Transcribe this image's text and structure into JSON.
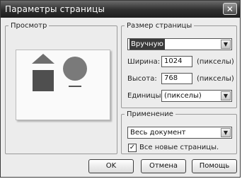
{
  "dialog": {
    "title": "Параметры страницы",
    "close_symbol": "✕"
  },
  "preview": {
    "legend": "Просмотр",
    "shapes": [
      "triangle",
      "square",
      "circle"
    ]
  },
  "page_size": {
    "legend": "Размер страницы",
    "preset": "Вручную",
    "width_label": "Ширина:",
    "width_value": "1024",
    "width_unit": "(пикселы)",
    "height_label": "Высота:",
    "height_value": "768",
    "height_unit": "(пикселы)",
    "units_label": "Единицы:",
    "units_value": "(пикселы)"
  },
  "apply": {
    "legend": "Применение",
    "scope": "Весь документ",
    "new_pages_label": "Все новые страницы.",
    "new_pages_checked": true
  },
  "buttons": {
    "ok": "OK",
    "cancel": "Отмена",
    "help": "Помощь"
  },
  "icons": {
    "dropdown": "chevron-down-icon",
    "close": "close-icon",
    "check": "check-icon"
  }
}
